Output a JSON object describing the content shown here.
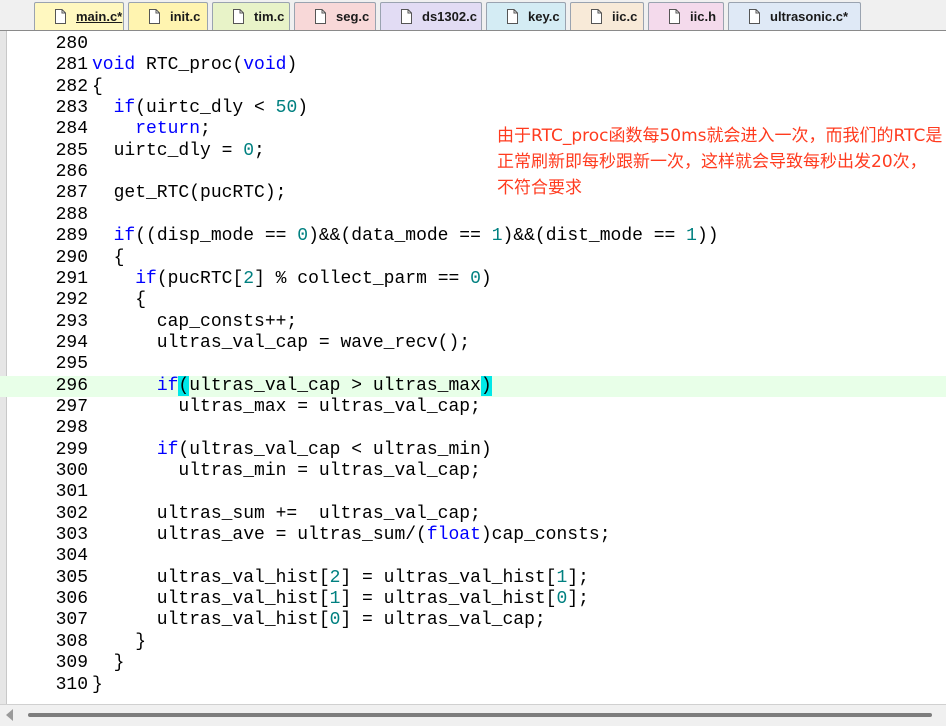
{
  "tabs": [
    {
      "label": "main.c*",
      "color": "#fff8c0",
      "active": true
    },
    {
      "label": "init.c",
      "color": "#fff4b0",
      "active": false
    },
    {
      "label": "tim.c",
      "color": "#e8f3c8",
      "active": false
    },
    {
      "label": "seg.c",
      "color": "#f8d8d8",
      "active": false
    },
    {
      "label": "ds1302.c",
      "color": "#e2dcf4",
      "active": false
    },
    {
      "label": "key.c",
      "color": "#d4ecf4",
      "active": false
    },
    {
      "label": "iic.c",
      "color": "#f8ead8",
      "active": false
    },
    {
      "label": "iic.h",
      "color": "#f4daec",
      "active": false
    },
    {
      "label": "ultrasonic.c*",
      "color": "#dfe9f6",
      "active": false
    }
  ],
  "code_lines": [
    {
      "n": "280",
      "t": ""
    },
    {
      "n": "281",
      "t": "<span class=\"kw\">void</span> RTC_proc(<span class=\"kw\">void</span>)"
    },
    {
      "n": "282",
      "t": "{"
    },
    {
      "n": "283",
      "t": "  <span class=\"kw\">if</span>(uirtc_dly &lt; <span class=\"num\">50</span>)"
    },
    {
      "n": "284",
      "t": "    <span class=\"kw\">return</span>;"
    },
    {
      "n": "285",
      "t": "  uirtc_dly = <span class=\"num\">0</span>;"
    },
    {
      "n": "286",
      "t": ""
    },
    {
      "n": "287",
      "t": "  get_RTC(pucRTC);"
    },
    {
      "n": "288",
      "t": ""
    },
    {
      "n": "289",
      "t": "  <span class=\"kw\">if</span>((disp_mode == <span class=\"num\">0</span>)&amp;&amp;(data_mode == <span class=\"num\">1</span>)&amp;&amp;(dist_mode == <span class=\"num\">1</span>))"
    },
    {
      "n": "290",
      "t": "  {"
    },
    {
      "n": "291",
      "t": "    <span class=\"kw\">if</span>(pucRTC[<span class=\"num\">2</span>] % collect_parm == <span class=\"num\">0</span>)"
    },
    {
      "n": "292",
      "t": "    {"
    },
    {
      "n": "293",
      "t": "      cap_consts++;"
    },
    {
      "n": "294",
      "t": "      ultras_val_cap = wave_recv();"
    },
    {
      "n": "295",
      "t": ""
    },
    {
      "n": "296",
      "t": "      <span class=\"kw\">if</span><span class=\"brace-hl\">(</span>ultras_val_cap &gt; ultras_max<span class=\"brace-hl\">)</span>",
      "hl": true
    },
    {
      "n": "297",
      "t": "        ultras_max = ultras_val_cap;"
    },
    {
      "n": "298",
      "t": ""
    },
    {
      "n": "299",
      "t": "      <span class=\"kw\">if</span>(ultras_val_cap &lt; ultras_min)"
    },
    {
      "n": "300",
      "t": "        ultras_min = ultras_val_cap;"
    },
    {
      "n": "301",
      "t": ""
    },
    {
      "n": "302",
      "t": "      ultras_sum +=  ultras_val_cap;"
    },
    {
      "n": "303",
      "t": "      ultras_ave = ultras_sum/(<span class=\"kw\">float</span>)cap_consts;"
    },
    {
      "n": "304",
      "t": ""
    },
    {
      "n": "305",
      "t": "      ultras_val_hist[<span class=\"num\">2</span>] = ultras_val_hist[<span class=\"num\">1</span>];"
    },
    {
      "n": "306",
      "t": "      ultras_val_hist[<span class=\"num\">1</span>] = ultras_val_hist[<span class=\"num\">0</span>];"
    },
    {
      "n": "307",
      "t": "      ultras_val_hist[<span class=\"num\">0</span>] = ultras_val_cap;"
    },
    {
      "n": "308",
      "t": "    }"
    },
    {
      "n": "309",
      "t": "  }"
    },
    {
      "n": "310",
      "t": "}"
    }
  ],
  "annotation": {
    "text": "由于RTC_proc函数每50ms就会进入一次，而我们的RTC是正常刷新即每秒跟新一次，这样就会导致每秒出发20次，不符合要求",
    "color": "#ff3b1f"
  },
  "colors": {
    "keyword": "#0000ff",
    "number": "#008080",
    "highlight_line": "#e8ffe8",
    "brace_match": "#00e8e8"
  }
}
